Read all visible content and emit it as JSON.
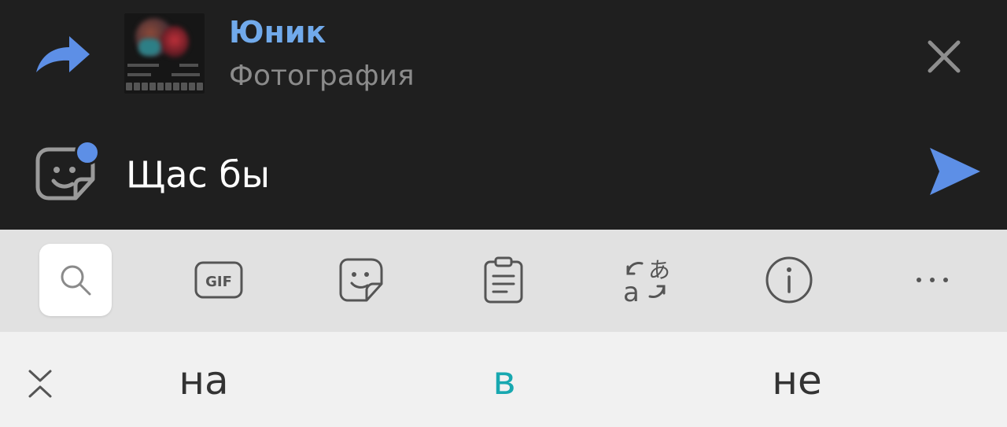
{
  "reply": {
    "author": "Юник",
    "attachment_type": "Фотография",
    "icon": "reply-arrow-icon",
    "thumbnail": "photo-thumbnail",
    "close_icon": "close-icon"
  },
  "composer": {
    "text": "Щас бы",
    "sticker_icon": "sticker-icon",
    "send_icon": "send-icon",
    "accent_color": "#71aaeb",
    "badge_color": "#5d8fe6"
  },
  "keyboard_toolbar": {
    "items": [
      {
        "name": "search",
        "icon": "search-icon",
        "active": true
      },
      {
        "name": "gif",
        "icon": "gif-icon",
        "label": "GIF"
      },
      {
        "name": "stickers",
        "icon": "sticker-icon"
      },
      {
        "name": "clipboard",
        "icon": "clipboard-icon"
      },
      {
        "name": "translate",
        "icon": "translate-icon"
      },
      {
        "name": "info",
        "icon": "info-icon"
      },
      {
        "name": "more",
        "icon": "more-icon"
      }
    ]
  },
  "suggestions": {
    "collapse_icon": "collapse-icon",
    "words": [
      "на",
      "в",
      "не"
    ],
    "highlight_color": "#18a8b0"
  }
}
